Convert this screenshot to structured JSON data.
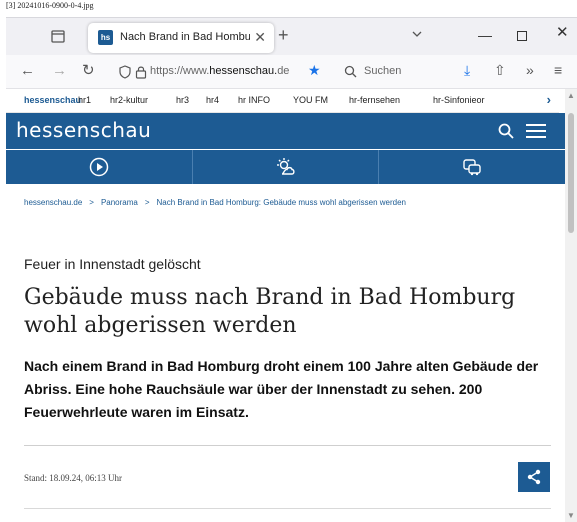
{
  "file_label": "[3] 20241016-0900-0-4.jpg",
  "browser": {
    "tab": {
      "favicon_text": "hs",
      "title": "Nach Brand in Bad Homburg: G",
      "close_glyph": "✕"
    },
    "new_tab_glyph": "+",
    "window_controls": {
      "minimize": "—",
      "close": "✕"
    },
    "nav": {
      "back": "←",
      "forward": "→",
      "reload": "↻"
    },
    "url": {
      "prefix": "https://www.",
      "domain": "hessenschau.",
      "rest": "de"
    },
    "bookmark_star": "★",
    "search_placeholder": "Suchen",
    "tools": {
      "download": "⤓",
      "share": "⇧",
      "overflow": "»",
      "menu": "≡"
    }
  },
  "bookmarks": {
    "items": [
      "hessenschau",
      "hr1",
      "hr2-kultur",
      "hr3",
      "hr4",
      "hr INFO",
      "YOU FM",
      "hr-fernsehen",
      "hr-Sinfonieor"
    ],
    "more_glyph": "›"
  },
  "site": {
    "logo": "hessenschau",
    "brand_color": "#1d5b93",
    "nav_icons": [
      "play-icon",
      "weather-icon",
      "traffic-icon"
    ]
  },
  "breadcrumb": {
    "items": [
      "hessenschau.de",
      "Panorama",
      "Nach Brand in Bad Homburg: Gebäude muss wohl abgerissen werden"
    ],
    "separator": ">"
  },
  "article": {
    "kicker": "Feuer in Innenstadt gelöscht",
    "headline": "Gebäude muss nach Brand in Bad Homburg wohl abgerissen werden",
    "teaser": "Nach einem Brand in Bad Homburg droht einem 100 Jahre alten Gebäude der Abriss. Eine hohe Rauchsäule war über der Innenstadt zu sehen. 200 Feuerwehrleute waren im Einsatz.",
    "stand": "Stand: 18.09.24, 06:13 Uhr"
  },
  "scrollbar": {
    "up": "▲",
    "down": "▼"
  }
}
